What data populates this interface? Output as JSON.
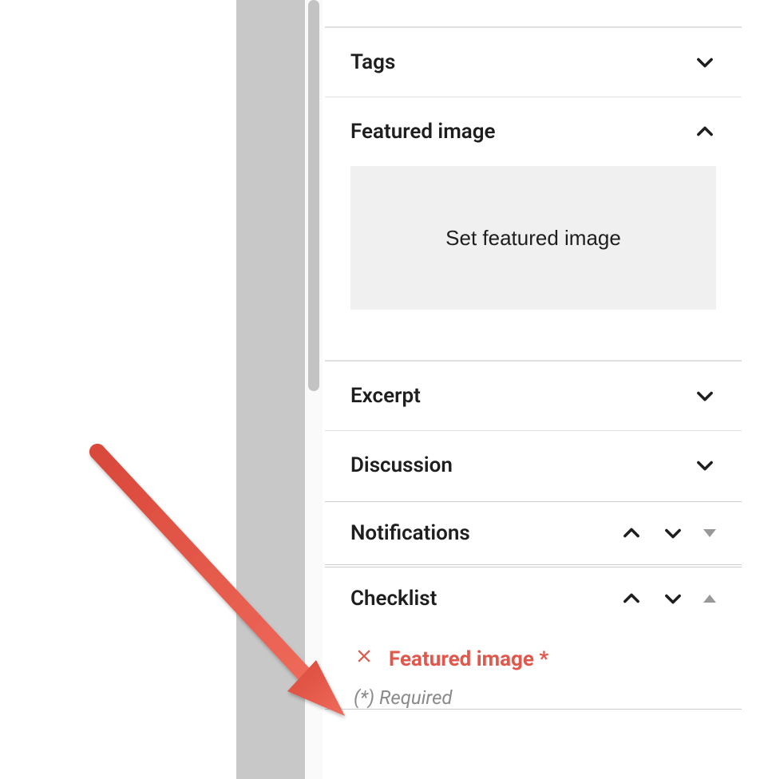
{
  "panels": {
    "tags": {
      "title": "Tags"
    },
    "featured_image": {
      "title": "Featured image",
      "set_button": "Set featured image"
    },
    "excerpt": {
      "title": "Excerpt"
    },
    "discussion": {
      "title": "Discussion"
    },
    "notifications": {
      "title": "Notifications"
    },
    "checklist": {
      "title": "Checklist",
      "items": [
        {
          "label": "Featured image *"
        }
      ],
      "required_note": "(*) Required"
    }
  },
  "colors": {
    "error": "#e1574c",
    "panel_bg": "#f0f0f0"
  }
}
